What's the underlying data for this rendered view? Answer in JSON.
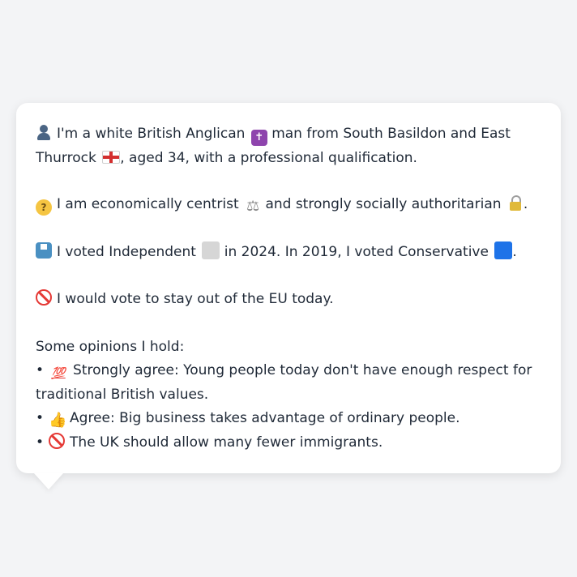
{
  "card": {
    "identity_line_1": "I'm a white British Anglican",
    "identity_line_1b": "man from South Basildon and East",
    "identity_line_2a": "Thurrock",
    "identity_line_2b": ", aged 34, with a professional qualification.",
    "economic_a": "I am economically centrist",
    "economic_b": "and strongly socially authoritarian",
    "economic_c": ".",
    "vote_a": "I voted Independent",
    "vote_b": "in 2024. In 2019, I voted Conservative",
    "vote_c": ".",
    "eu_line": "I would vote to stay out of the EU today.",
    "opinions_heading": "Some opinions I hold:",
    "bullet_symbol": "•",
    "opinions": [
      {
        "icon": "hundred-points-icon",
        "text_line_1": "Strongly agree: Young people today don't have enough respect for",
        "text_line_2": "traditional British values."
      },
      {
        "icon": "thumbs-up-icon",
        "text": "Agree: Big business takes advantage of ordinary people."
      },
      {
        "icon": "no-entry-icon",
        "text": "The UK should allow many fewer immigrants."
      }
    ],
    "hundred_glyph": "💯",
    "colors": {
      "background": "#f3f4f6",
      "card": "#ffffff",
      "text": "#1f2937"
    }
  }
}
